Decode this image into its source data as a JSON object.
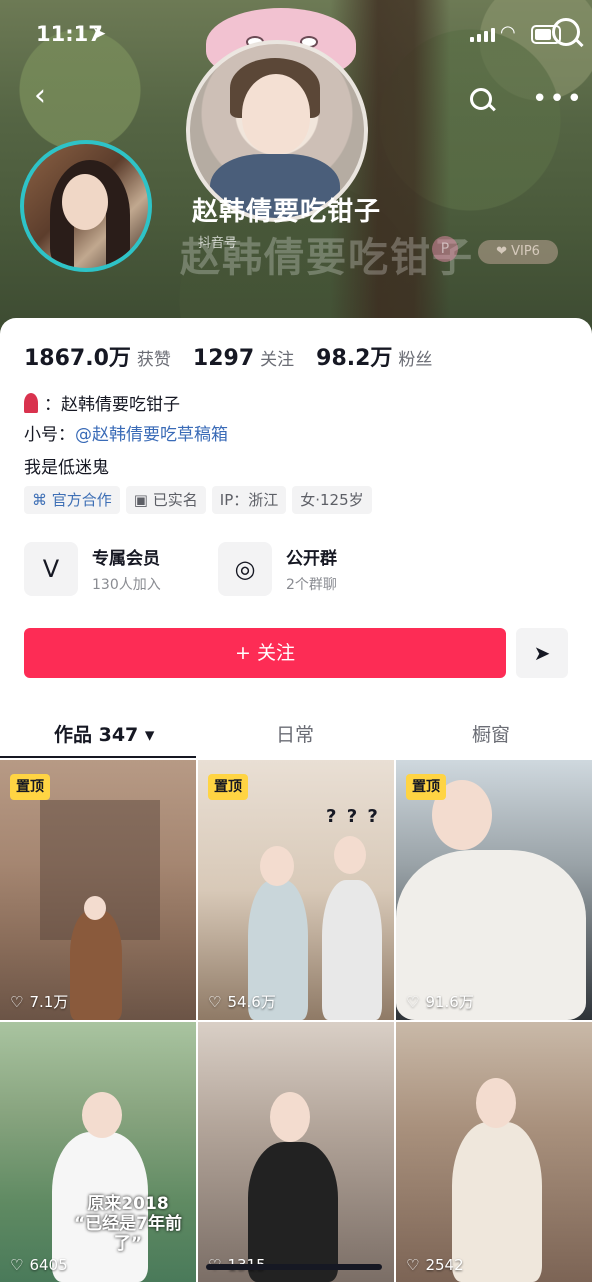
{
  "status_bar": {
    "time": "11:17"
  },
  "profile": {
    "nickname": "赵韩倩要吃钳子",
    "douyin_id_label": "抖音号",
    "vip_badge": "VIP6",
    "stats": [
      {
        "value": "1867.0万",
        "label": "获赞"
      },
      {
        "value": "1297",
        "label": "关注"
      },
      {
        "value": "98.2万",
        "label": "粉丝"
      }
    ],
    "bio_line1": "：赵韩倩要吃钳子",
    "bio_line2_prefix": "小号：",
    "bio_line2_mention": "@赵韩倩要吃草稿箱",
    "bio_line3": "我是低迷鬼",
    "tags": [
      "官方合作",
      "已实名",
      "IP：浙江",
      "女·125岁"
    ]
  },
  "entries": [
    {
      "title": "专属会员",
      "subtitle": "130人加入",
      "icon": "v-logo-icon"
    },
    {
      "title": "公开群",
      "subtitle": "2个群聊",
      "icon": "chat-group-icon"
    }
  ],
  "actions": {
    "follow_label": "+ 关注",
    "share_icon": "send-icon"
  },
  "tabs": [
    {
      "label": "作品 347 ▾",
      "active": true
    },
    {
      "label": "日常",
      "active": false
    },
    {
      "label": "橱窗",
      "active": false
    }
  ],
  "videos": [
    {
      "likes": "7.1万",
      "pinned": true,
      "pin_label": "置顶"
    },
    {
      "likes": "54.6万",
      "pinned": true,
      "pin_label": "置顶",
      "overlay": "? ? ?"
    },
    {
      "likes": "91.6万",
      "pinned": true,
      "pin_label": "置顶"
    },
    {
      "likes": "6405",
      "pinned": false,
      "caption_line1": "原来2018",
      "caption_line2": "“已经是7年前了”"
    },
    {
      "likes": "1315",
      "pinned": false
    },
    {
      "likes": "2542",
      "pinned": false
    }
  ],
  "colors": {
    "accent": "#fd2c55",
    "pin": "#ffd443",
    "avatar_ring": "#2ec3c7",
    "mention": "#3a6bb7"
  }
}
